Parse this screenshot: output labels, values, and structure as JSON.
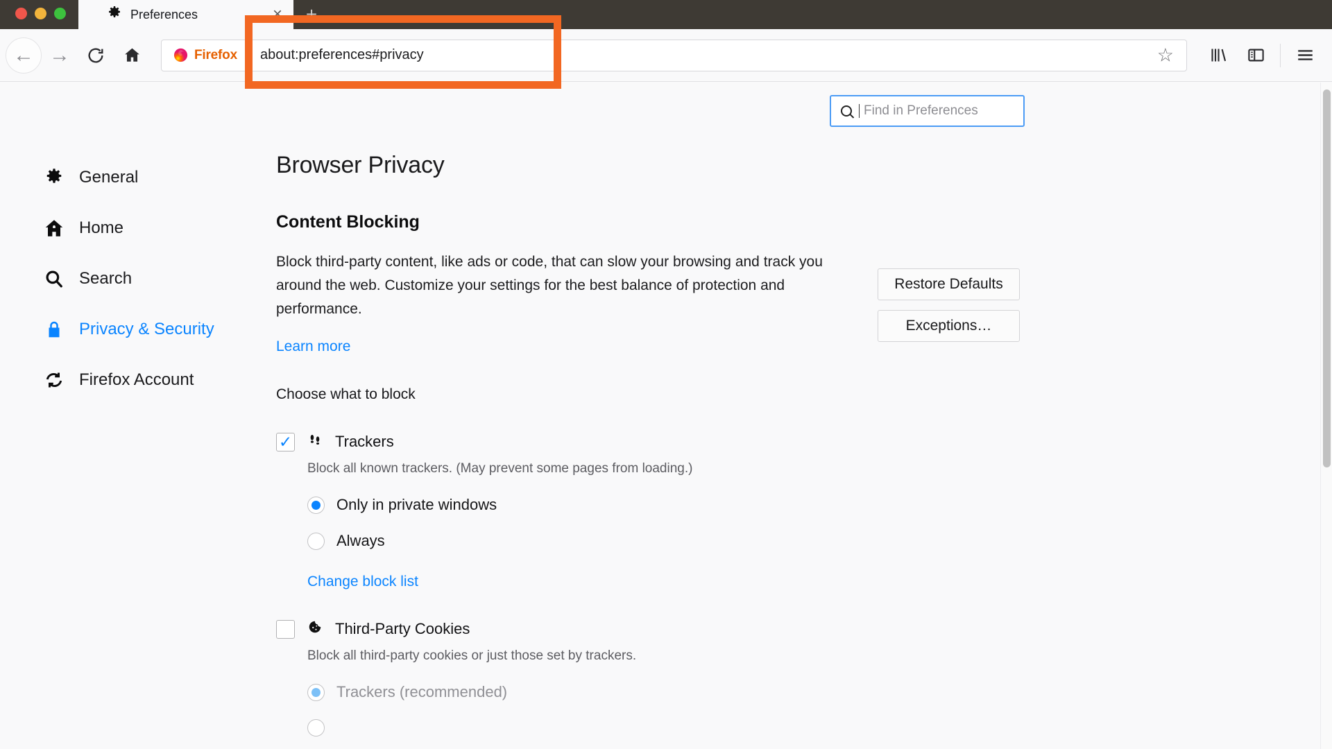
{
  "window": {
    "traffic_lights": [
      "close",
      "minimize",
      "maximize"
    ],
    "colors": {
      "close": "#f0564b",
      "minimize": "#f2b43c",
      "maximize": "#3dc23e",
      "accent_blue": "#0a84ff",
      "firefox_orange": "#e66000",
      "highlight_orange": "#f26722"
    }
  },
  "tab": {
    "icon": "gear-icon",
    "title": "Preferences",
    "close_glyph": "×",
    "new_tab_glyph": "+"
  },
  "toolbar": {
    "back_glyph": "←",
    "forward_glyph": "→",
    "reload_glyph": "↻",
    "home_glyph": "⌂",
    "identity_label": "Firefox",
    "url": "about:preferences#privacy",
    "bookmark_glyph": "☆",
    "library_name": "library-icon",
    "sidebar_name": "sidebar-icon",
    "menu_glyph": "☰"
  },
  "search": {
    "placeholder": "Find in Preferences",
    "value": ""
  },
  "sidebar": {
    "items": [
      {
        "label": "General",
        "icon": "gear-icon",
        "glyph": "⚙",
        "active": false
      },
      {
        "label": "Home",
        "icon": "house-icon",
        "glyph": "⌂",
        "active": false
      },
      {
        "label": "Search",
        "icon": "magnifier-icon",
        "glyph": "⌕",
        "active": false
      },
      {
        "label": "Privacy & Security",
        "icon": "lock-icon",
        "glyph": "🔒",
        "active": true
      },
      {
        "label": "Firefox Account",
        "icon": "sync-icon",
        "glyph": "↻",
        "active": false
      }
    ]
  },
  "main": {
    "page_title": "Browser Privacy",
    "section_title": "Content Blocking",
    "description": "Block third-party content, like ads or code, that can slow your browsing and track you around the web. Customize your settings for the best balance of protection and performance.",
    "learn_more": "Learn more",
    "choose_label": "Choose what to block",
    "buttons": {
      "restore_defaults": "Restore Defaults",
      "exceptions": "Exceptions…"
    },
    "trackers": {
      "checked": true,
      "check_glyph": "✓",
      "icon": "footprints-icon",
      "title": "Trackers",
      "subtitle": "Block all known trackers. (May prevent some pages from loading.)",
      "options": [
        {
          "label": "Only in private windows",
          "selected": true
        },
        {
          "label": "Always",
          "selected": false
        }
      ],
      "change_block_list": "Change block list"
    },
    "third_party_cookies": {
      "checked": false,
      "icon": "cookie-icon",
      "title": "Third-Party Cookies",
      "subtitle": "Block all third-party cookies or just those set by trackers.",
      "options": [
        {
          "label": "Trackers (recommended)",
          "selected": true
        }
      ]
    }
  }
}
